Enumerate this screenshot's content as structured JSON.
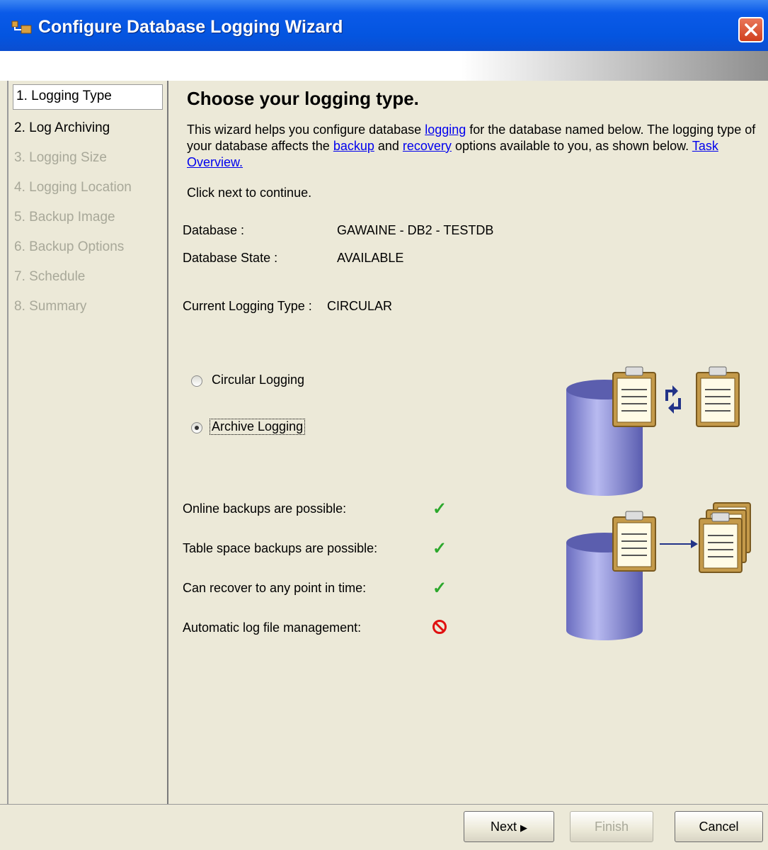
{
  "window": {
    "title": "Configure Database Logging Wizard",
    "icon": "wizard-icon",
    "close_icon": "close-icon"
  },
  "sidebar": {
    "steps": [
      {
        "label": "1. Logging Type",
        "state": "active"
      },
      {
        "label": "2. Log Archiving",
        "state": "enabled"
      },
      {
        "label": "3. Logging Size",
        "state": "disabled"
      },
      {
        "label": "4. Logging Location",
        "state": "disabled"
      },
      {
        "label": "5. Backup Image",
        "state": "disabled"
      },
      {
        "label": "6. Backup Options",
        "state": "disabled"
      },
      {
        "label": "7. Schedule",
        "state": "disabled"
      },
      {
        "label": "8. Summary",
        "state": "disabled"
      }
    ]
  },
  "main": {
    "heading": "Choose your logging type.",
    "intro": {
      "p1": "This wizard helps you configure database ",
      "link_logging": "logging",
      "p2": " for the database named below. The logging type of your database affects the ",
      "link_backup": "backup",
      "p3": " and ",
      "link_recovery": "recovery",
      "p4": " options available to you, as shown below. ",
      "link_overview": "Task Overview."
    },
    "continue_text": "Click next to continue.",
    "database_label": "Database :",
    "database_value": "GAWAINE - DB2 - TESTDB",
    "state_label": "Database State :",
    "state_value": "AVAILABLE",
    "current_type_label": "Current Logging Type :",
    "current_type_value": "CIRCULAR",
    "options": [
      {
        "label": "Circular Logging",
        "selected": false
      },
      {
        "label": "Archive Logging",
        "selected": true
      }
    ],
    "features": [
      {
        "label": "Online backups are possible:",
        "status": "check-icon"
      },
      {
        "label": "Table space backups are possible:",
        "status": "check-icon"
      },
      {
        "label": "Can recover to any point in time:",
        "status": "check-icon"
      },
      {
        "label": "Automatic log file management:",
        "status": "prohibited-icon"
      }
    ]
  },
  "buttons": {
    "next": "Next",
    "finish": "Finish",
    "cancel": "Cancel"
  },
  "colors": {
    "titlebar": "#0455e0",
    "link": "#0000ee",
    "check": "#2ca82c",
    "prohibited": "#e01010",
    "cylinder": "#9b9de0"
  }
}
